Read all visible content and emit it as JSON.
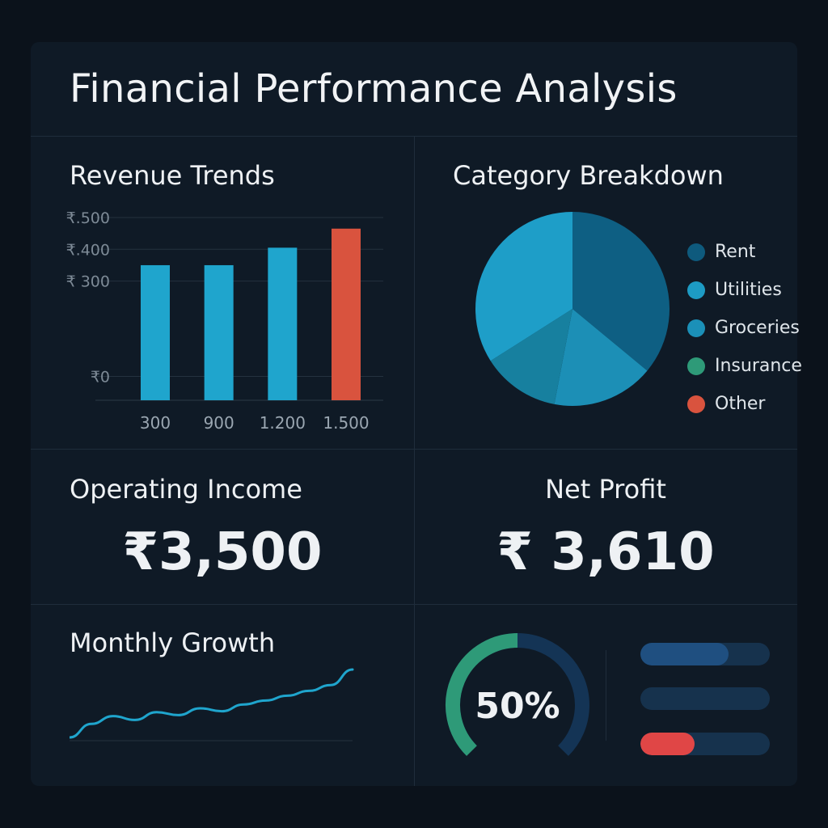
{
  "dashboard": {
    "title": "Financial Performance Analysis"
  },
  "colors": {
    "background": "#0b121b",
    "panel": "#0f1a26",
    "bar_blue": "#1fa5cd",
    "bar_red": "#d9533e",
    "line": "#1fa5cd",
    "gauge_green": "#2e9a78",
    "gauge_track": "#143455",
    "progress_track": "#16324d",
    "progress_blue": "#1f4f80",
    "progress_red": "#e04646"
  },
  "revenue": {
    "title": "Revenue Trends"
  },
  "category": {
    "title": "Category Breakdown",
    "legend": [
      {
        "label": "Rent",
        "color": "#0e5a7d"
      },
      {
        "label": "Utilities",
        "color": "#1d9bc4"
      },
      {
        "label": "Groceries",
        "color": "#1b90b8"
      },
      {
        "label": "Insurance",
        "color": "#2e9a78"
      },
      {
        "label": "Other",
        "color": "#d9533e"
      }
    ]
  },
  "operating_income": {
    "title": "Operating Income",
    "value": "₹3,500"
  },
  "net_profit": {
    "title": "Net Profit",
    "value": "₹ 3,610"
  },
  "monthly_growth": {
    "title": "Monthly Growth"
  },
  "gauge": {
    "label": "50%",
    "percent": 50
  },
  "progress_bars": [
    {
      "fraction": 0.68,
      "color": "#1f4f80"
    },
    {
      "fraction": 0.0,
      "color": "#1f4f80"
    },
    {
      "fraction": 0.42,
      "color": "#e04646"
    }
  ],
  "chart_data": [
    {
      "type": "bar",
      "title": "Revenue Trends",
      "categories": [
        "300",
        "900",
        "1.200",
        "1.500"
      ],
      "y_tick_labels": [
        "₹0",
        "₹ 300",
        "₹.400",
        "₹.500"
      ],
      "y_ticks": [
        0,
        300,
        400,
        500
      ],
      "values": [
        350,
        350,
        405,
        465
      ],
      "bar_colors": [
        "#1fa5cd",
        "#1fa5cd",
        "#1fa5cd",
        "#d9533e"
      ],
      "ylim": [
        -75,
        500
      ],
      "grid": true
    },
    {
      "type": "pie",
      "title": "Category Breakdown",
      "labels": [
        "Rent",
        "Utilities",
        "Groceries",
        "Insurance",
        "Other"
      ],
      "values": [
        36,
        17,
        13,
        34,
        0
      ],
      "legend": "right"
    },
    {
      "type": "line",
      "title": "Monthly Growth",
      "x": [
        0,
        1,
        2,
        3,
        4,
        5,
        6,
        7,
        8,
        9,
        10,
        11,
        12,
        13
      ],
      "y": [
        0,
        14,
        22,
        18,
        26,
        23,
        30,
        27,
        34,
        38,
        43,
        48,
        54,
        70
      ],
      "grid": false
    }
  ]
}
